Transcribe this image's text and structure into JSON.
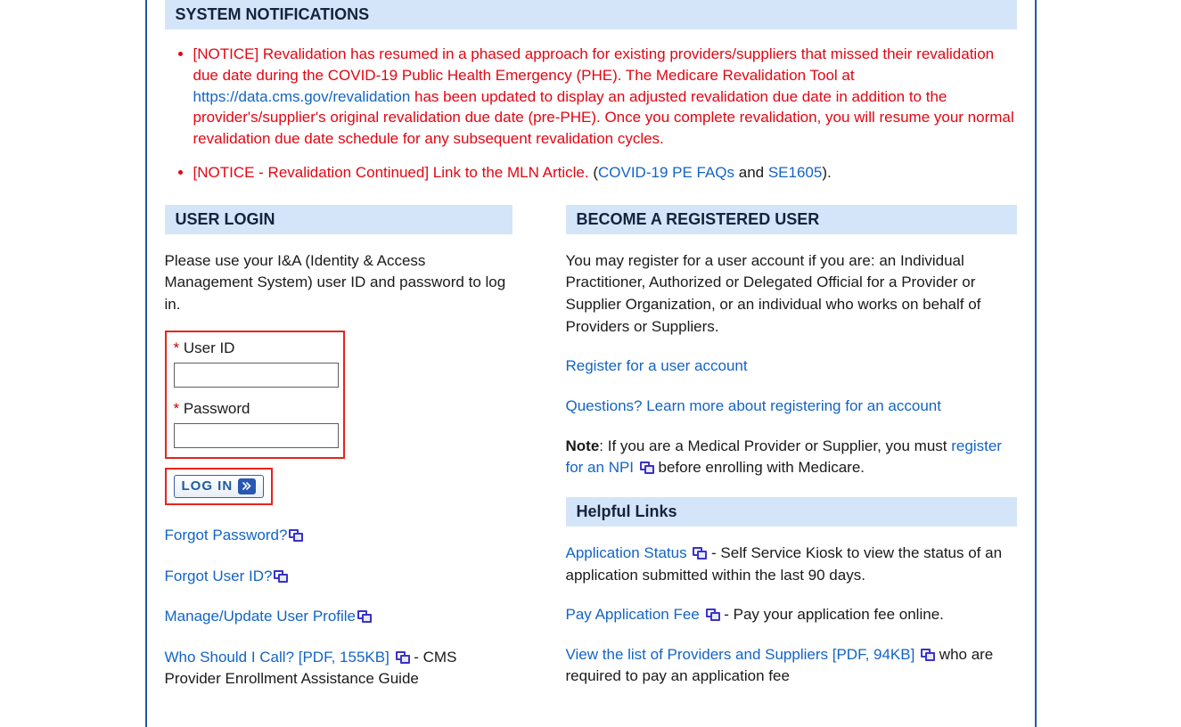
{
  "notifications_heading": "SYSTEM NOTIFICATIONS",
  "notices": [
    {
      "prefix": "[NOTICE] Revalidation has resumed in a phased approach for existing providers/suppliers that missed their revalidation due date during the COVID-19 Public Health Emergency (PHE). The Medicare Revalidation Tool at ",
      "link1_text": "https://data.cms.gov/revalidation",
      "suffix": " has been updated to display an adjusted revalidation due date in addition to the provider's/supplier's original revalidation due date (pre-PHE). Once you complete revalidation, you will resume your normal revalidation due date schedule for any subsequent revalidation cycles."
    },
    {
      "prefix": "[NOTICE - Revalidation Continued] Link to the MLN Article. ",
      "open_paren": "(",
      "link1_text": "COVID-19 PE FAQs",
      "mid": " and ",
      "link2_text": "SE1605",
      "close": ").",
      "dot": ""
    }
  ],
  "login_heading": "USER LOGIN",
  "login_instruction": "Please use your I&A (Identity & Access Management System) user ID and password to log in.",
  "required_mark": "*",
  "user_id_label": " User ID",
  "password_label": " Password",
  "login_button": "LOG IN",
  "login_links": {
    "forgot_password": "Forgot Password?",
    "forgot_user_id": "Forgot User ID?",
    "manage_profile": "Manage/Update User Profile",
    "who_call": "Who Should I Call? [PDF, 155KB]",
    "who_call_desc": " - CMS Provider Enrollment Assistance Guide"
  },
  "register_heading": "BECOME A REGISTERED USER",
  "register_intro": "You may register for a user account if you are: an Individual Practitioner, Authorized or Delegated Official for a Provider or Supplier Organization, or an individual who works on behalf of Providers or Suppliers.",
  "register_link": "Register for a user account",
  "questions_link": "Questions? Learn more about registering for an account",
  "note_label": "Note",
  "note_text": ": If you are a Medical Provider or Supplier, you must ",
  "note_link": "register for an NPI",
  "note_suffix": " before enrolling with Medicare.",
  "helpful_heading": "Helpful Links",
  "helpful": {
    "app_status_link": "Application Status",
    "app_status_desc": " - Self Service Kiosk to view the status of an application submitted within the last 90 days.",
    "pay_fee_link": "Pay Application Fee",
    "pay_fee_desc": " - Pay your application fee online.",
    "view_list_link": "View the list of Providers and Suppliers [PDF, 94KB]",
    "view_list_desc": " who are required to pay an application fee"
  }
}
